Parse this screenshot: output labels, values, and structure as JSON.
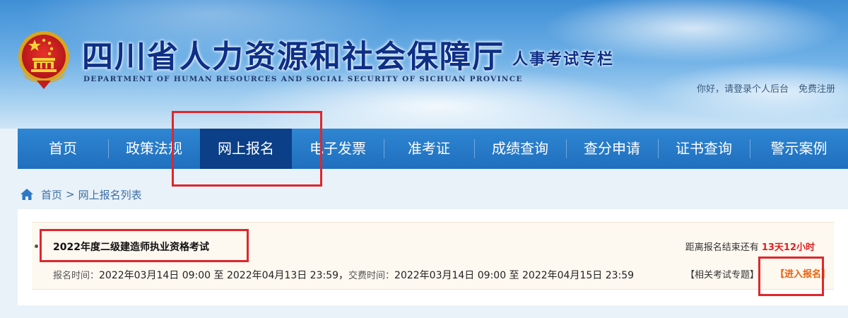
{
  "header": {
    "site_title": "四川省人力资源和社会保障厅",
    "site_subtitle": "DEPARTMENT OF HUMAN RESOURCES AND SOCIAL SECURITY OF SICHUAN PROVINCE",
    "column_title": "人事考试专栏",
    "user_greeting": "你好，请登录个人后台",
    "register_link": "免费注册"
  },
  "nav": {
    "items": [
      {
        "label": "首页"
      },
      {
        "label": "政策法规"
      },
      {
        "label": "网上报名"
      },
      {
        "label": "电子发票"
      },
      {
        "label": "准考证"
      },
      {
        "label": "成绩查询"
      },
      {
        "label": "查分申请"
      },
      {
        "label": "证书查询"
      },
      {
        "label": "警示案例"
      }
    ],
    "active": "网上报名"
  },
  "breadcrumb": {
    "home": "首页",
    "separator": ">",
    "current": "网上报名列表"
  },
  "exam": {
    "title": "2022年度二级建造师执业资格考试",
    "countdown_label": "距离报名结束还有",
    "countdown_value": "13天12小时",
    "signup_label": "报名时间：",
    "signup_time": "2022年03月14日 09:00 至 2022年04月13日 23:59，",
    "payment_label": "交费时间：",
    "payment_time": "2022年03月14日 09:00 至 2022年04月15日 23:59",
    "related_link": "【相关考试专题】",
    "enter_link": "【进入报名】"
  },
  "colors": {
    "nav_bg": "#1f6fbe",
    "nav_active": "#0b3f87",
    "title_blue": "#0d2f86",
    "countdown_red": "#e02020",
    "enter_orange": "#e8620f",
    "highlight_red": "#e0262b"
  },
  "icons": {
    "emblem": "national-emblem-icon",
    "home": "home-icon"
  }
}
